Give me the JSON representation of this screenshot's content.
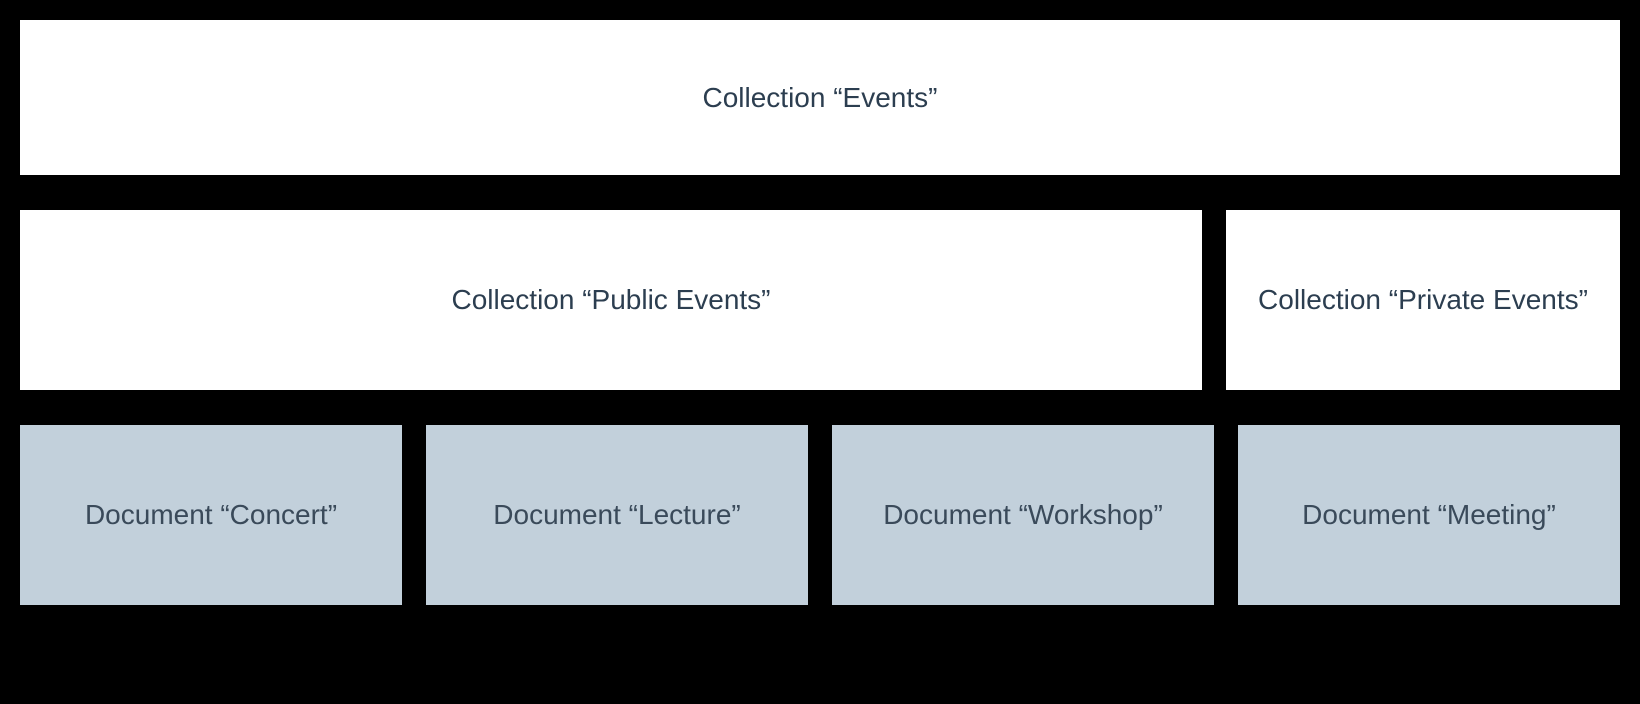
{
  "hierarchy": {
    "root": {
      "label": "Collection “Events”"
    },
    "middle": {
      "public": {
        "label": "Collection “Public Events”"
      },
      "private": {
        "label": "Collection “Private Events”"
      }
    },
    "documents": {
      "concert": {
        "label": "Document “Concert”"
      },
      "lecture": {
        "label": "Document “Lecture”"
      },
      "workshop": {
        "label": "Document “Workshop”"
      },
      "meeting": {
        "label": "Document “Meeting”"
      }
    }
  }
}
